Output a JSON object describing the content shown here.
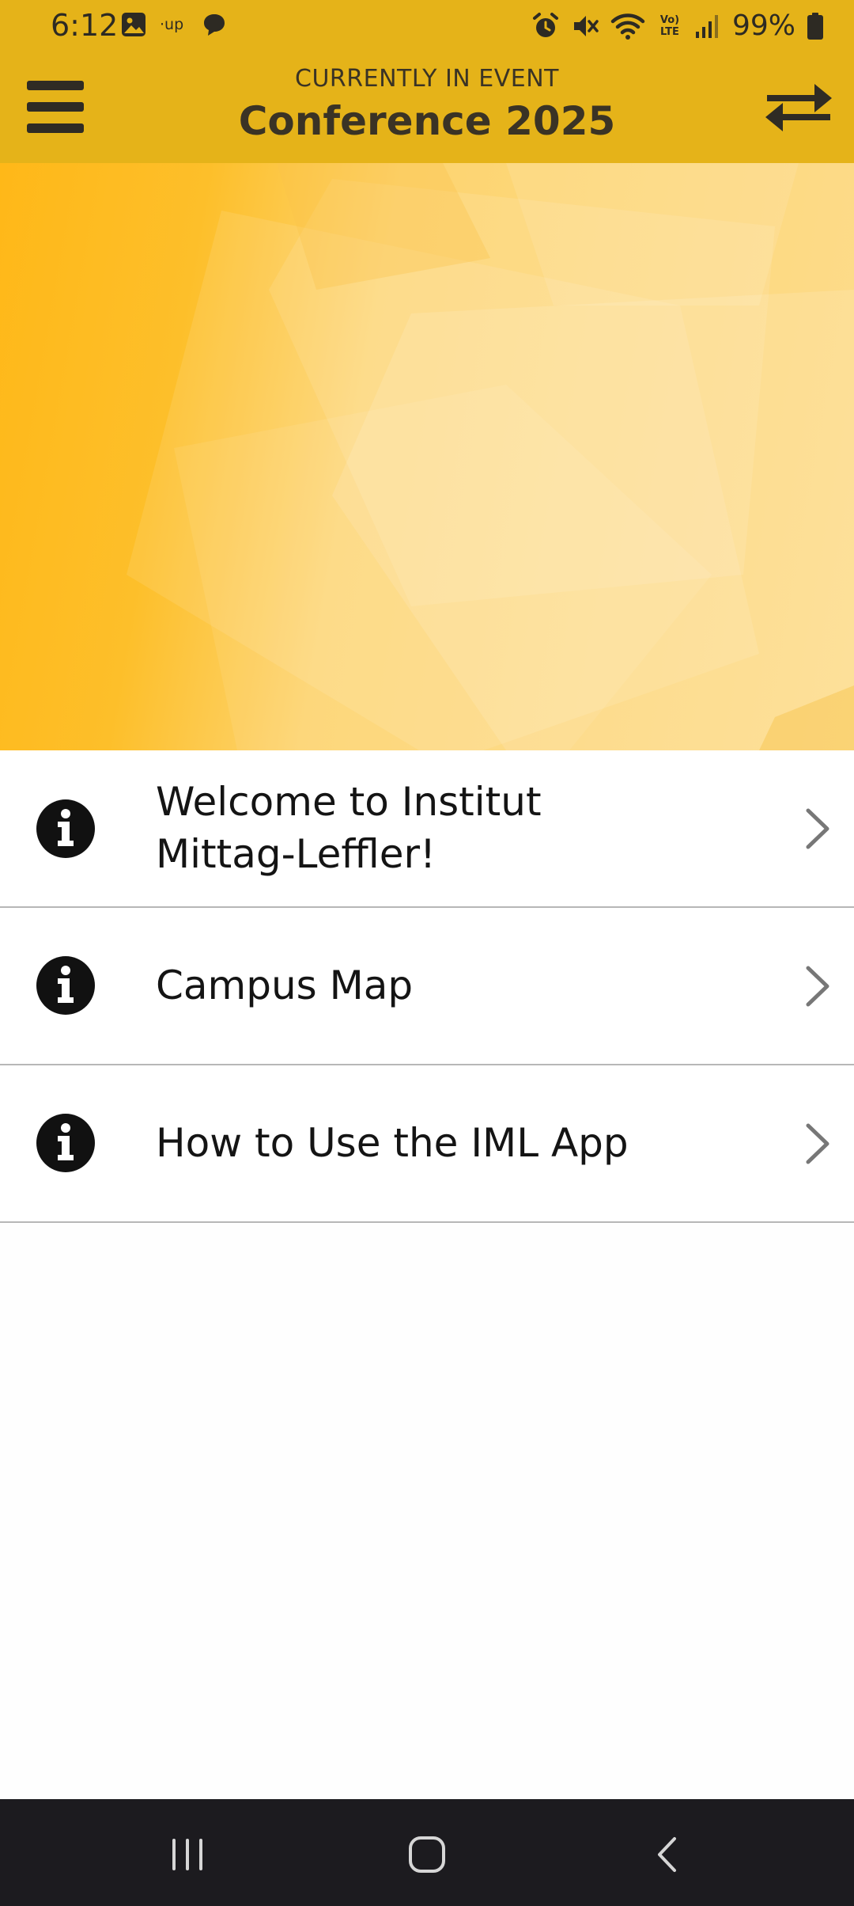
{
  "status_bar": {
    "time": "6:12",
    "battery": "99%",
    "network_label": "Vo) LTE"
  },
  "header": {
    "subtitle": "CURRENTLY IN EVENT",
    "title": "Conference 2025"
  },
  "menu": {
    "items": [
      {
        "line1": "Welcome to Institut",
        "line2": "Mittag-Leffler!",
        "icon": "info-icon"
      },
      {
        "label": "Campus Map",
        "icon": "info-icon"
      },
      {
        "label": "How to Use the IML App",
        "icon": "info-icon"
      }
    ]
  },
  "colors": {
    "header": "#e5b319",
    "banner_start": "#ffb818",
    "banner_end": "#fddc8c",
    "nav_bar": "#1c1b1f"
  }
}
